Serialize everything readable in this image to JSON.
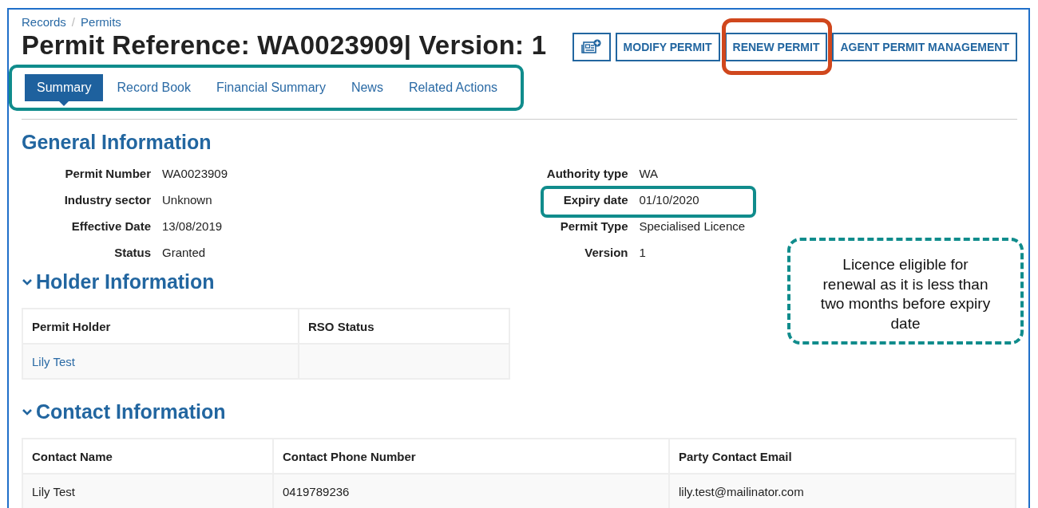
{
  "breadcrumb": [
    "Records",
    "Permits"
  ],
  "breadcrumb_separator": "/",
  "title": "Permit Reference: WA0023909| Version: 1",
  "actions": [
    {
      "kind": "icon",
      "highlighted": false
    },
    {
      "kind": "text",
      "label": "MODIFY PERMIT",
      "highlighted": false
    },
    {
      "kind": "text",
      "label": "RENEW PERMIT",
      "highlighted": true
    },
    {
      "kind": "text",
      "label": "AGENT PERMIT MANAGEMENT",
      "highlighted": false
    }
  ],
  "tabs_highlighted": true,
  "tabs": [
    {
      "label": "Summary",
      "selected": true
    },
    {
      "label": "Record Book",
      "selected": false
    },
    {
      "label": "Financial Summary",
      "selected": false
    },
    {
      "label": "News",
      "selected": false
    },
    {
      "label": "Related Actions",
      "selected": false
    }
  ],
  "general": {
    "heading": "General Information",
    "left_fields": [
      {
        "label": "Permit Number",
        "value": "WA0023909",
        "highlighted": false
      },
      {
        "label": "Industry sector",
        "value": "Unknown",
        "highlighted": false
      },
      {
        "label": "Effective Date",
        "value": "13/08/2019",
        "highlighted": false
      },
      {
        "label": "Status",
        "value": "Granted",
        "highlighted": false
      }
    ],
    "right_fields": [
      {
        "label": "Authority type",
        "value": "WA",
        "highlighted": false
      },
      {
        "label": "Expiry date",
        "value": "01/10/2020",
        "highlighted": true
      },
      {
        "label": "Permit Type",
        "value": "Specialised Licence",
        "highlighted": false
      },
      {
        "label": "Version",
        "value": "1",
        "highlighted": false
      }
    ]
  },
  "callout": "Licence eligible for renewal as it is less than two months before expiry date",
  "holder": {
    "heading": "Holder Information",
    "expanded": true,
    "columns": [
      "Permit Holder",
      "RSO Status"
    ],
    "rows": [
      {
        "kind": "link",
        "cells": [
          "Lily Test",
          ""
        ]
      }
    ]
  },
  "contact": {
    "heading": "Contact Information",
    "expanded": true,
    "columns": [
      "Contact Name",
      "Contact Phone Number",
      "Party Contact Email"
    ],
    "rows": [
      {
        "kind": "text",
        "cells": [
          "Lily Test",
          "0419789236",
          "lily.test@mailinator.com"
        ]
      }
    ]
  }
}
